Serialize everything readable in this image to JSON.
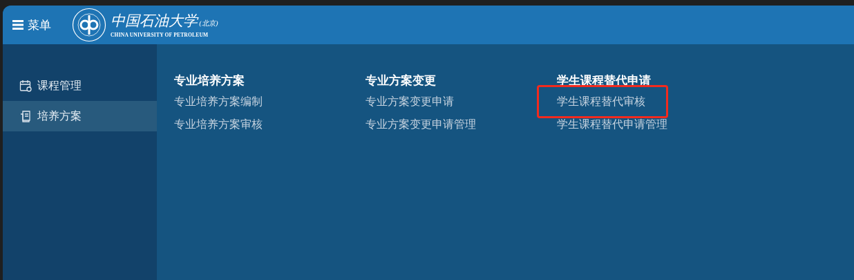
{
  "header": {
    "menu_label": "菜单",
    "logo": {
      "name_cn": "中国石油大学",
      "name_suffix": "(北京)",
      "name_en": "CHINA UNIVERSITY OF PETROLEUM"
    }
  },
  "sidebar": {
    "items": [
      {
        "label": "课程管理",
        "kind": "calendar",
        "selected": false
      },
      {
        "label": "培养方案",
        "kind": "document",
        "selected": true
      }
    ]
  },
  "menu_columns": [
    {
      "heading": "专业培养方案",
      "links": [
        {
          "label": "专业培养方案编制",
          "highlighted": false
        },
        {
          "label": "专业培养方案审核",
          "highlighted": false
        }
      ]
    },
    {
      "heading": "专业方案变更",
      "links": [
        {
          "label": "专业方案变更申请",
          "highlighted": false
        },
        {
          "label": "专业方案变更申请管理",
          "highlighted": false
        }
      ]
    },
    {
      "heading": "学生课程替代申请",
      "links": [
        {
          "label": "学生课程替代审核",
          "highlighted": true
        },
        {
          "label": "学生课程替代申请管理",
          "highlighted": false
        }
      ]
    }
  ]
}
